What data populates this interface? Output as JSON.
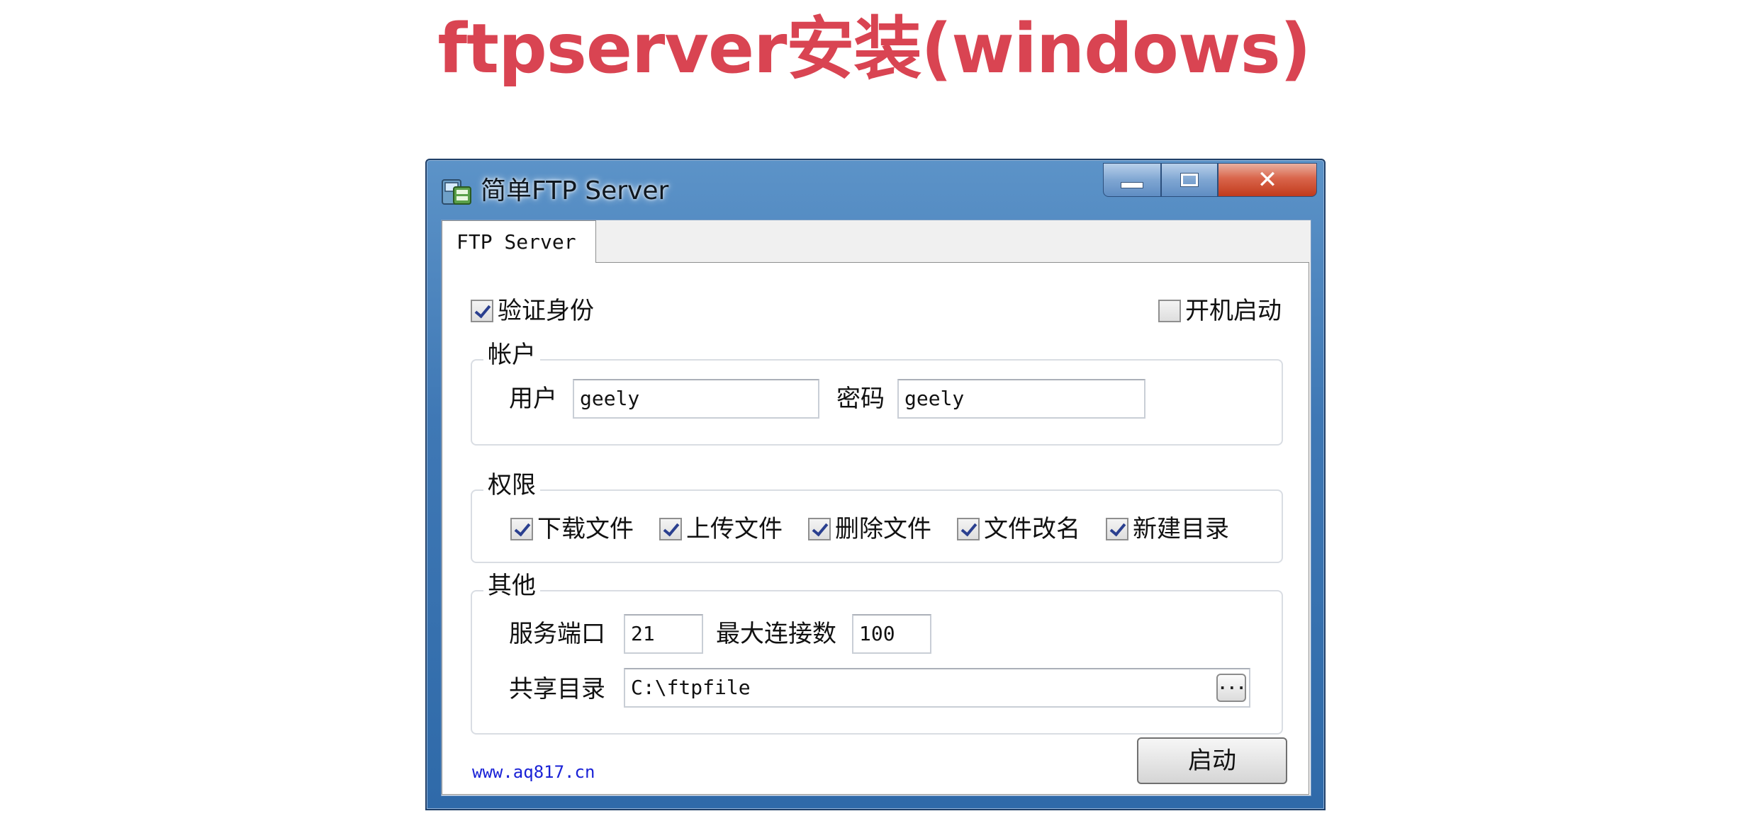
{
  "slide": {
    "title": "ftpserver安装(windows)"
  },
  "window": {
    "title": "简单FTP Server",
    "controls": {
      "minimize_icon": "minimize-icon",
      "maximize_icon": "maximize-icon",
      "close_symbol": "✕"
    }
  },
  "tab": {
    "label": "FTP Server"
  },
  "options": {
    "auth": {
      "label": "验证身份",
      "checked": true
    },
    "autostart": {
      "label": "开机启动",
      "checked": false
    }
  },
  "account": {
    "legend": "帐户",
    "user_label": "用户",
    "user_value": "geely",
    "password_label": "密码",
    "password_value": "geely"
  },
  "permissions": {
    "legend": "权限",
    "items": [
      {
        "label": "下载文件",
        "checked": true
      },
      {
        "label": "上传文件",
        "checked": true
      },
      {
        "label": "删除文件",
        "checked": true
      },
      {
        "label": "文件改名",
        "checked": true
      },
      {
        "label": "新建目录",
        "checked": true
      }
    ]
  },
  "other": {
    "legend": "其他",
    "port_label": "服务端口",
    "port_value": "21",
    "maxconn_label": "最大连接数",
    "maxconn_value": "100",
    "sharedir_label": "共享目录",
    "sharedir_value": "C:\\ftpfile",
    "browse_label": "..."
  },
  "footer": {
    "link": "www.aq817.cn",
    "start_button": "启动"
  },
  "colors": {
    "title_red": "#d94452",
    "link_blue": "#1a22d6",
    "window_frame": "#3f78b5"
  }
}
